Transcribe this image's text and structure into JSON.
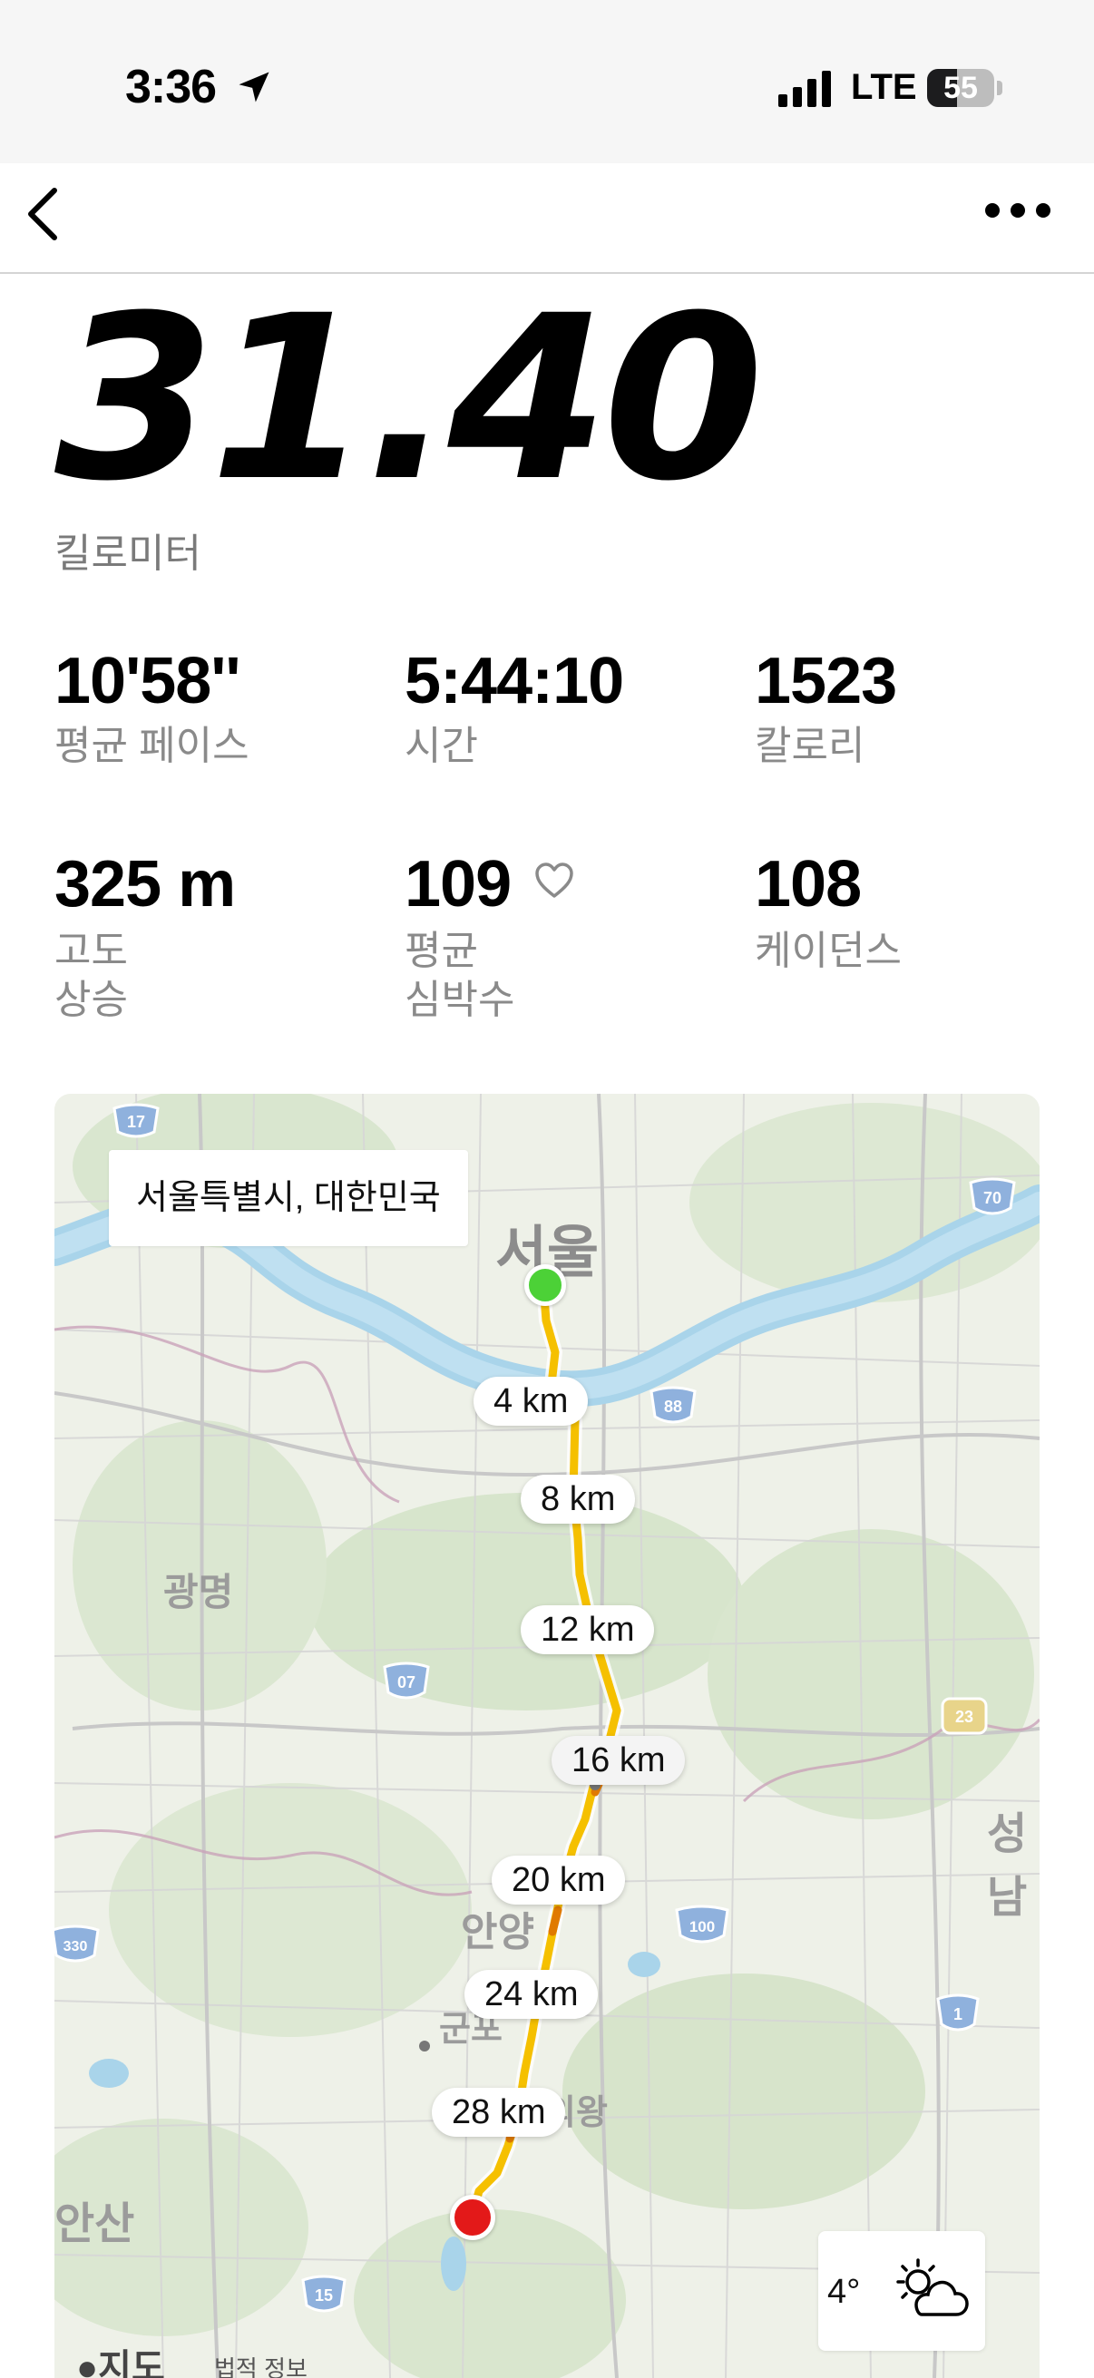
{
  "status_bar": {
    "time": "3:36",
    "network": "LTE",
    "battery": "55",
    "battery_fraction": 0.45
  },
  "header": {
    "back_icon": "chevron-left-icon",
    "more_icon": "ellipsis-icon"
  },
  "summary": {
    "distance": "31.40",
    "distance_unit": "킬로미터"
  },
  "stats": [
    {
      "value": "10'58''",
      "label": "평균 페이스"
    },
    {
      "value": "5:44:10",
      "label": "시간"
    },
    {
      "value": "1523",
      "label": "칼로리"
    },
    {
      "value": "325 m",
      "label_line1": "고도",
      "label_line2": "상승"
    },
    {
      "value": "109",
      "label_line1": "평균",
      "label_line2": "심박수"
    },
    {
      "value": "108",
      "label": "케이던스"
    }
  ],
  "map": {
    "region": "서울특별시, 대한민국",
    "places": {
      "seoul": "서울",
      "gwangmyeong": "광명",
      "anyang": "안양",
      "gunpo": "군포",
      "uiwang": "의왕",
      "ansan": "안산",
      "seongnam": "성남"
    },
    "route_color": "#f5c000",
    "km_markers": [
      "4 km",
      "8 km",
      "12 km",
      "16 km",
      "20 km",
      "24 km",
      "28 km"
    ],
    "road_shields": [
      "17",
      "70",
      "88",
      "07",
      "23",
      "330",
      "100",
      "1",
      "15"
    ],
    "weather": {
      "temp": "4°",
      "icon": "partly-cloudy-day-icon"
    },
    "attribution": {
      "brand": "지도",
      "legal": "법적 정보"
    }
  }
}
